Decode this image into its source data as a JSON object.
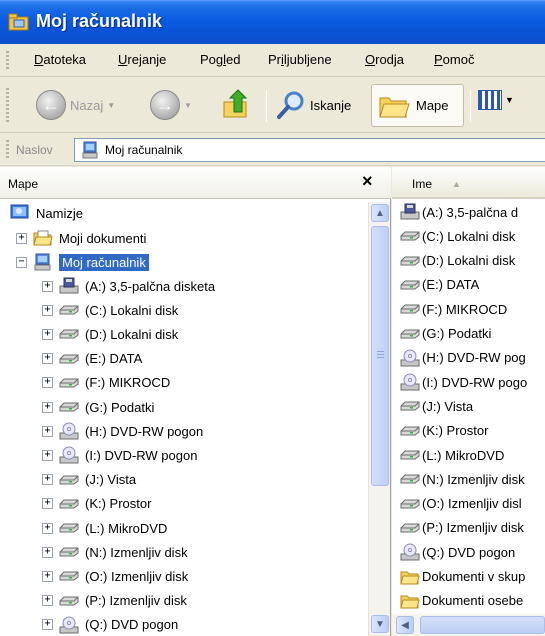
{
  "window": {
    "title": "Moj računalnik"
  },
  "menu": [
    {
      "label": "Datoteka",
      "pre": "",
      "u": "D",
      "post": "atoteka"
    },
    {
      "label": "Urejanje",
      "pre": "",
      "u": "U",
      "post": "rejanje"
    },
    {
      "label": "Pogled",
      "pre": "Pog",
      "u": "l",
      "post": "ed"
    },
    {
      "label": "Priljubljene",
      "pre": "Pr",
      "u": "i",
      "post": "ljubljene"
    },
    {
      "label": "Orodja",
      "pre": "",
      "u": "O",
      "post": "rodja"
    },
    {
      "label": "Pomoč",
      "pre": "",
      "u": "P",
      "post": "omoč"
    }
  ],
  "toolbar": {
    "back_label": "Nazaj",
    "search_label": "Iskanje",
    "folders_label": "Mape"
  },
  "address": {
    "label": "Naslov",
    "value": "Moj računalnik"
  },
  "folders_pane": {
    "title": "Mape",
    "close": "×",
    "tree": {
      "desktop": "Namizje",
      "my_documents": "Moji dokumenti",
      "my_computer": "Moj računalnik",
      "drives": [
        {
          "label": "(A:) 3,5-palčna disketa",
          "icon": "floppy-icon"
        },
        {
          "label": "(C:) Lokalni disk",
          "icon": "drive-icon"
        },
        {
          "label": "(D:) Lokalni disk",
          "icon": "drive-icon"
        },
        {
          "label": "(E:) DATA",
          "icon": "drive-icon"
        },
        {
          "label": "(F:) MIKROCD",
          "icon": "drive-icon"
        },
        {
          "label": "(G:) Podatki",
          "icon": "drive-icon"
        },
        {
          "label": "(H:) DVD-RW pogon",
          "icon": "cd-icon"
        },
        {
          "label": "(I:) DVD-RW pogon",
          "icon": "cd-icon"
        },
        {
          "label": "(J:) Vista",
          "icon": "drive-icon"
        },
        {
          "label": "(K:) Prostor",
          "icon": "drive-icon"
        },
        {
          "label": "(L:) MikroDVD",
          "icon": "drive-icon"
        },
        {
          "label": "(N:) Izmenljiv disk",
          "icon": "drive-icon"
        },
        {
          "label": "(O:) Izmenljiv disk",
          "icon": "drive-icon"
        },
        {
          "label": "(P:) Izmenljiv disk",
          "icon": "drive-icon"
        },
        {
          "label": "(Q:) DVD pogon",
          "icon": "cd-icon"
        }
      ]
    }
  },
  "files_pane": {
    "column_header": "Ime",
    "items": [
      {
        "label": "(A:) 3,5-palčna d",
        "icon": "floppy-icon"
      },
      {
        "label": "(C:) Lokalni disk",
        "icon": "drive-icon"
      },
      {
        "label": "(D:) Lokalni disk",
        "icon": "drive-icon"
      },
      {
        "label": "(E:) DATA",
        "icon": "drive-icon"
      },
      {
        "label": "(F:) MIKROCD",
        "icon": "drive-icon"
      },
      {
        "label": "(G:) Podatki",
        "icon": "drive-icon"
      },
      {
        "label": "(H:) DVD-RW pog",
        "icon": "cd-icon"
      },
      {
        "label": "(I:) DVD-RW pogo",
        "icon": "cd-icon"
      },
      {
        "label": "(J:) Vista",
        "icon": "drive-icon"
      },
      {
        "label": "(K:) Prostor",
        "icon": "drive-icon"
      },
      {
        "label": "(L:) MikroDVD",
        "icon": "drive-icon"
      },
      {
        "label": "(N:) Izmenljiv disk",
        "icon": "drive-icon"
      },
      {
        "label": "(O:) Izmenljiv disl",
        "icon": "drive-icon"
      },
      {
        "label": "(P:) Izmenljiv disk",
        "icon": "drive-icon"
      },
      {
        "label": "(Q:) DVD pogon",
        "icon": "cd-icon"
      },
      {
        "label": "Dokumenti v skup",
        "icon": "folder-icon"
      },
      {
        "label": "Dokumenti osebe",
        "icon": "folder-icon"
      }
    ]
  },
  "colors": {
    "title_bar": "#0a54d6",
    "selection": "#316ac5",
    "window_bg": "#ece9d8"
  }
}
